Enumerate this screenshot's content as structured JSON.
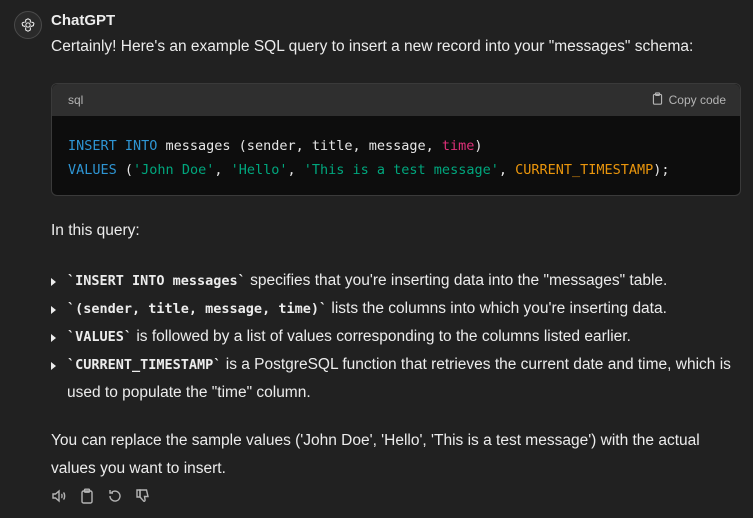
{
  "message": {
    "sender": "ChatGPT",
    "intro": "Certainly! Here's an example SQL query to insert a new record into your \"messages\" schema:",
    "code_block": {
      "language": "sql",
      "copy_label": "Copy code",
      "line1": {
        "kw1": "INSERT INTO",
        "table": " messages (sender, title, message, ",
        "col_time": "time",
        "close": ")"
      },
      "line2": {
        "kw": "VALUES",
        "open": " (",
        "v1": "'John Doe'",
        "sep1": ", ",
        "v2": "'Hello'",
        "sep2": ", ",
        "v3": "'This is a test message'",
        "sep3": ", ",
        "fn": "CURRENT_TIMESTAMP",
        "close": ");"
      }
    },
    "query_heading": "In this query:",
    "bullets": [
      {
        "code": "`INSERT INTO messages`",
        "text": " specifies that you're inserting data into the \"messages\" table."
      },
      {
        "code": "`(sender, title, message, time)`",
        "text": " lists the columns into which you're inserting data."
      },
      {
        "code": "`VALUES`",
        "text": " is followed by a list of values corresponding to the columns listed earlier."
      },
      {
        "code": "`CURRENT_TIMESTAMP`",
        "text": " is a PostgreSQL function that retrieves the current date and time, which is used to populate the \"time\" column."
      }
    ],
    "outro": "You can replace the sample values ('John Doe', 'Hello', 'This is a test message') with the actual values you want to insert.",
    "actions": [
      "speaker-icon",
      "copy-icon",
      "regenerate-icon",
      "thumbs-down-icon"
    ]
  },
  "colors": {
    "background": "#212121",
    "code_background": "#0d0d0d",
    "keyword": "#2e95d3",
    "string": "#00a67d",
    "function": "#e9950c",
    "highlight": "#df3079"
  }
}
